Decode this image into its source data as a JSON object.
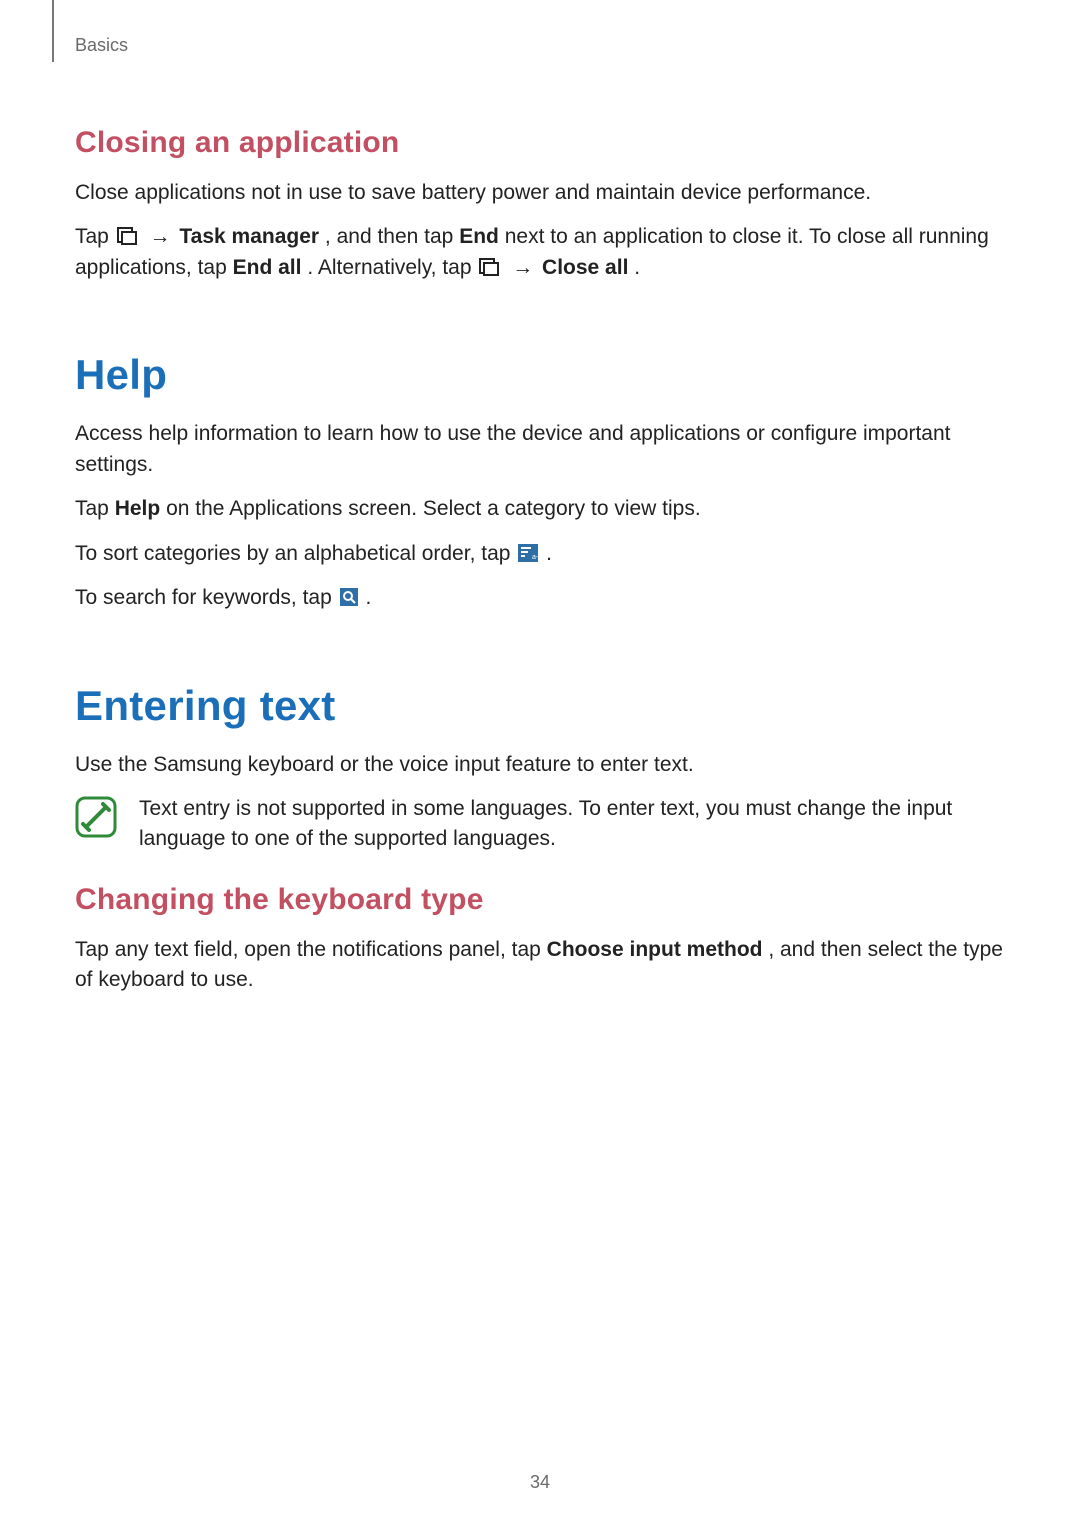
{
  "breadcrumb": "Basics",
  "page_number": "34",
  "s_closing": {
    "heading": "Closing an application",
    "p1": "Close applications not in use to save battery power and maintain device performance.",
    "p2a": "Tap ",
    "p2_arrow1": " → ",
    "p2_taskmgr": "Task manager",
    "p2b": ", and then tap ",
    "p2_end": "End",
    "p2c": " next to an application to close it. To close all running applications, tap ",
    "p2_endall": "End all",
    "p2d": ". Alternatively, tap ",
    "p2_arrow2": " → ",
    "p2_closeall": "Close all",
    "p2e": "."
  },
  "s_help": {
    "heading": "Help",
    "p1": "Access help information to learn how to use the device and applications or configure important settings.",
    "p2a": "Tap ",
    "p2_help": "Help",
    "p2b": " on the Applications screen. Select a category to view tips.",
    "p3a": "To sort categories by an alphabetical order, tap ",
    "p3b": ".",
    "p4a": "To search for keywords, tap ",
    "p4b": "."
  },
  "s_text": {
    "heading": "Entering text",
    "p1": "Use the Samsung keyboard or the voice input feature to enter text.",
    "note": "Text entry is not supported in some languages. To enter text, you must change the input language to one of the supported languages."
  },
  "s_kbtype": {
    "heading": "Changing the keyboard type",
    "p1a": "Tap any text field, open the notifications panel, tap ",
    "p1_choose": "Choose input method",
    "p1b": ", and then select the type of keyboard to use."
  }
}
